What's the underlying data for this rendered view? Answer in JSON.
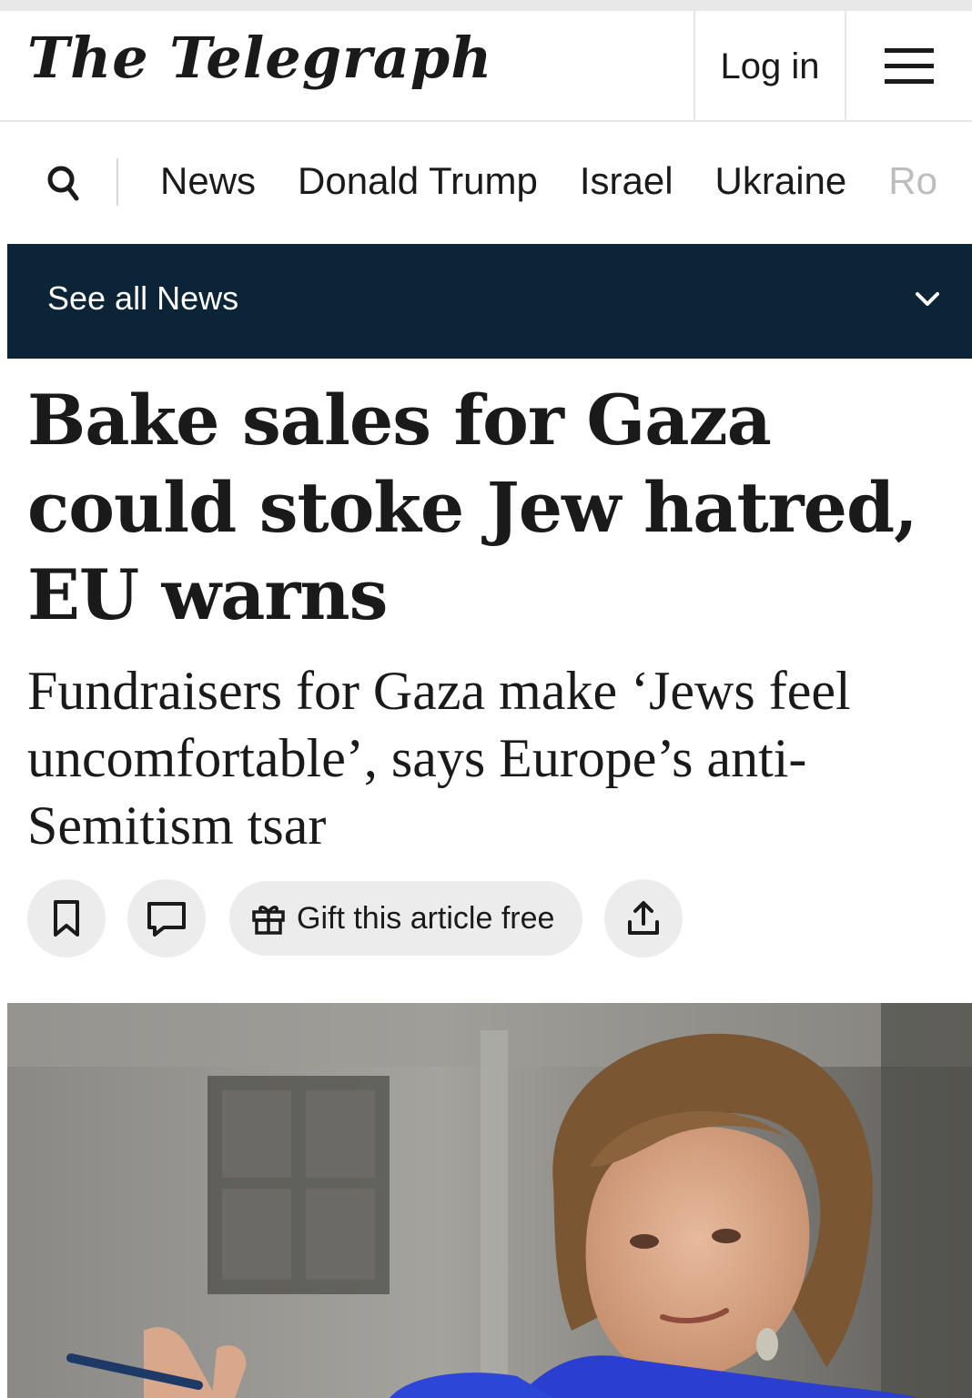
{
  "header": {
    "masthead": "The Telegraph",
    "login_label": "Log in",
    "menu_icon": "hamburger-menu-icon"
  },
  "nav": {
    "search_icon": "search-icon",
    "items": [
      {
        "label": "News"
      },
      {
        "label": "Donald Trump"
      },
      {
        "label": "Israel"
      },
      {
        "label": "Ukraine"
      },
      {
        "label": "Ro"
      }
    ]
  },
  "section": {
    "label": "See all News",
    "icon": "chevron-down-icon",
    "background": "#0b2436"
  },
  "article": {
    "headline": "Bake sales for Gaza could stoke Jew hatred, EU warns",
    "standfirst": "Fundraisers for Gaza make ‘Jews feel uncomfortable’, says Europe’s anti-Semitism tsar",
    "actions": {
      "bookmark_icon": "bookmark-icon",
      "comment_icon": "comment-icon",
      "gift_label": "Gift this article free",
      "gift_icon": "gift-icon",
      "share_icon": "share-icon"
    }
  }
}
